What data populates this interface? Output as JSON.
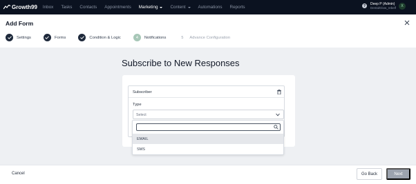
{
  "topnav": {
    "brand": "Growth99",
    "items": [
      {
        "label": "Inbox",
        "active": false
      },
      {
        "label": "Tasks",
        "active": false
      },
      {
        "label": "Contacts",
        "active": false
      },
      {
        "label": "Appointments",
        "active": false
      },
      {
        "label": "Marketing",
        "active": true,
        "has_caret": true
      },
      {
        "label": "Content",
        "active": false,
        "has_caret": true
      },
      {
        "label": "Automations",
        "active": false
      },
      {
        "label": "Reports",
        "active": false
      }
    ],
    "user_name": "Deep P (Admin)",
    "user_company": "DentalGlow_rebelf",
    "avatar_initial": "X"
  },
  "header": {
    "title": "Add Form",
    "steps": [
      {
        "number": "",
        "label": "Settings",
        "state": "done"
      },
      {
        "number": "",
        "label": "Forms",
        "state": "done"
      },
      {
        "number": "",
        "label": "Condition & Logic",
        "state": "done"
      },
      {
        "number": "4",
        "label": "Notifications",
        "state": "current"
      },
      {
        "number": "5",
        "label": "Advance Configuration",
        "state": "pending"
      }
    ]
  },
  "main": {
    "title": "Subscribe to New Responses",
    "subscriber_label": "Subscriber",
    "type_label": "Type",
    "select_placeholder": "Select",
    "dropdown": {
      "search_value": "",
      "options": [
        "EMAIL",
        "SMS"
      ],
      "highlighted_index": 0
    }
  },
  "footer": {
    "cancel": "Cancel",
    "go_back": "Go Back",
    "next": "Next"
  },
  "colors": {
    "nav_bg": "#0b1220",
    "step_done": "#1e293b",
    "step_current": "#a7c7b7",
    "next_disabled": "#9ca3af",
    "page_bg": "#eef0f3"
  }
}
